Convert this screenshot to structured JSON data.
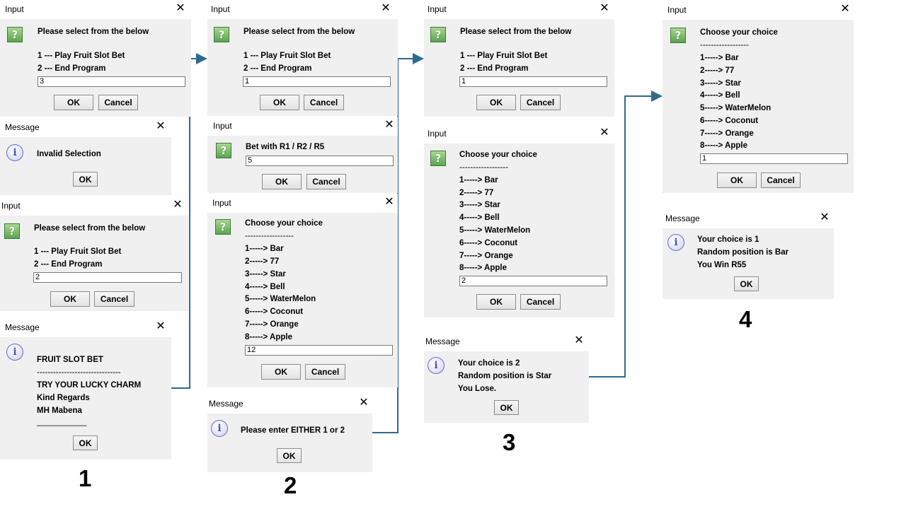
{
  "input_title": "Input",
  "message_title": "Message",
  "close_glyph": "✕",
  "ok_label": "OK",
  "cancel_label": "Cancel",
  "menu": {
    "prompt": "Please select from the below",
    "opt1_num": "1",
    "opt1_text": " --- Play Fruit Slot Bet",
    "opt2_num": "2",
    "opt2_text": " --- End Program"
  },
  "choice": {
    "prompt": "Choose your choice",
    "divider": "------------------",
    "items": [
      {
        "num": "1",
        "text": "-----> Bar"
      },
      {
        "num": "2",
        "text": "-----> 77"
      },
      {
        "num": "3",
        "text": "-----> Star"
      },
      {
        "num": "4",
        "text": "-----> Bell"
      },
      {
        "num": "5",
        "text": "-----> WaterMelon"
      },
      {
        "num": "6",
        "text": "-----> Coconut"
      },
      {
        "num": "7",
        "text": "-----> Orange"
      },
      {
        "num": "8",
        "text": "-----> Apple"
      }
    ]
  },
  "col1": {
    "input1_value": "3",
    "msg1_text": "Invalid Selection",
    "input2_value": "2",
    "msg2_lines": [
      "FRUIT SLOT BET",
      "-------------------------------",
      "TRY YOUR LUCKY CHARM",
      "Kind Regards",
      "MH Mabena",
      "___________"
    ],
    "step": "1"
  },
  "col2": {
    "input1_value": "1",
    "bet_prompt": "Bet with R1 / R2 / R5",
    "bet_value": "5",
    "choice_value": "12",
    "msg_text": "Please enter EITHER 1 or 2",
    "step": "2"
  },
  "col3": {
    "input1_value": "1",
    "choice_value": "2",
    "msg_lines": [
      "Your choice is 2",
      "Random position is Star",
      "You Lose."
    ],
    "step": "3"
  },
  "col4": {
    "choice_value": "1",
    "msg_lines": [
      "Your choice is 1",
      "Random position is Bar",
      "You Win R55"
    ],
    "step": "4"
  }
}
